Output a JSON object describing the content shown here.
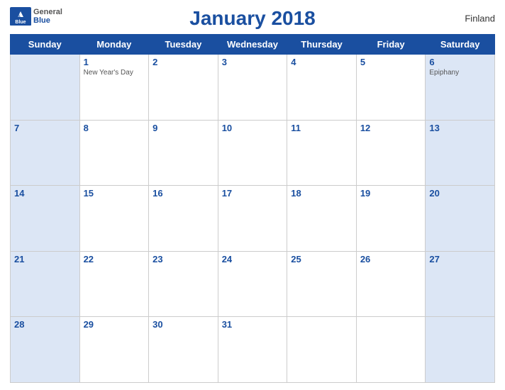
{
  "header": {
    "title": "January 2018",
    "country": "Finland",
    "logo_general": "General",
    "logo_blue": "Blue"
  },
  "days_of_week": [
    "Sunday",
    "Monday",
    "Tuesday",
    "Wednesday",
    "Thursday",
    "Friday",
    "Saturday"
  ],
  "weeks": [
    [
      {
        "day": "",
        "holiday": ""
      },
      {
        "day": "1",
        "holiday": "New Year's Day"
      },
      {
        "day": "2",
        "holiday": ""
      },
      {
        "day": "3",
        "holiday": ""
      },
      {
        "day": "4",
        "holiday": ""
      },
      {
        "day": "5",
        "holiday": ""
      },
      {
        "day": "6",
        "holiday": "Epiphany"
      }
    ],
    [
      {
        "day": "7",
        "holiday": ""
      },
      {
        "day": "8",
        "holiday": ""
      },
      {
        "day": "9",
        "holiday": ""
      },
      {
        "day": "10",
        "holiday": ""
      },
      {
        "day": "11",
        "holiday": ""
      },
      {
        "day": "12",
        "holiday": ""
      },
      {
        "day": "13",
        "holiday": ""
      }
    ],
    [
      {
        "day": "14",
        "holiday": ""
      },
      {
        "day": "15",
        "holiday": ""
      },
      {
        "day": "16",
        "holiday": ""
      },
      {
        "day": "17",
        "holiday": ""
      },
      {
        "day": "18",
        "holiday": ""
      },
      {
        "day": "19",
        "holiday": ""
      },
      {
        "day": "20",
        "holiday": ""
      }
    ],
    [
      {
        "day": "21",
        "holiday": ""
      },
      {
        "day": "22",
        "holiday": ""
      },
      {
        "day": "23",
        "holiday": ""
      },
      {
        "day": "24",
        "holiday": ""
      },
      {
        "day": "25",
        "holiday": ""
      },
      {
        "day": "26",
        "holiday": ""
      },
      {
        "day": "27",
        "holiday": ""
      }
    ],
    [
      {
        "day": "28",
        "holiday": ""
      },
      {
        "day": "29",
        "holiday": ""
      },
      {
        "day": "30",
        "holiday": ""
      },
      {
        "day": "31",
        "holiday": ""
      },
      {
        "day": "",
        "holiday": ""
      },
      {
        "day": "",
        "holiday": ""
      },
      {
        "day": "",
        "holiday": ""
      }
    ]
  ],
  "colors": {
    "header_bg": "#1a4fa0",
    "weekend_cell_bg": "#dce6f5",
    "day_num_color": "#1a4fa0"
  }
}
